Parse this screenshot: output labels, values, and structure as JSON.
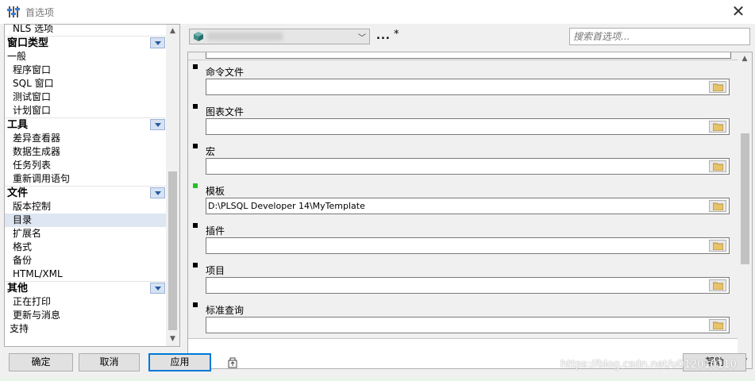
{
  "window": {
    "title": "首选项",
    "close_symbol": "✕",
    "icon": "sliders-icon"
  },
  "tree": {
    "items": [
      {
        "type": "item",
        "label": "NLS 选项"
      },
      {
        "type": "category",
        "label": "窗口类型"
      },
      {
        "type": "general",
        "label": "一般"
      },
      {
        "type": "item",
        "label": "程序窗口"
      },
      {
        "type": "item",
        "label": "SQL 窗口"
      },
      {
        "type": "item",
        "label": "测试窗口"
      },
      {
        "type": "item",
        "label": "计划窗口"
      },
      {
        "type": "category",
        "label": "工具"
      },
      {
        "type": "item",
        "label": "差异查看器"
      },
      {
        "type": "item",
        "label": "数据生成器"
      },
      {
        "type": "item",
        "label": "任务列表"
      },
      {
        "type": "item",
        "label": "重新调用语句"
      },
      {
        "type": "category",
        "label": "文件"
      },
      {
        "type": "item",
        "label": "版本控制"
      },
      {
        "type": "item",
        "label": "目录",
        "selected": true
      },
      {
        "type": "item",
        "label": "扩展名"
      },
      {
        "type": "item",
        "label": "格式"
      },
      {
        "type": "item",
        "label": "备份"
      },
      {
        "type": "item",
        "label": "HTML/XML"
      },
      {
        "type": "category",
        "label": "其他"
      },
      {
        "type": "item",
        "label": "正在打印"
      },
      {
        "type": "item",
        "label": "更新与消息"
      },
      {
        "type": "support",
        "label": "支持"
      }
    ]
  },
  "toolbar": {
    "connection_value": "",
    "more_label": "...",
    "modified_mark": "*",
    "search_placeholder": "搜索首选项..."
  },
  "prefs": [
    {
      "label": "命令文件",
      "value": "",
      "marker": "black"
    },
    {
      "label": "图表文件",
      "value": "",
      "marker": "black"
    },
    {
      "label": "宏",
      "value": "",
      "marker": "black"
    },
    {
      "label": "模板",
      "value": "D:\\PLSQL Developer 14\\MyTemplate",
      "marker": "green"
    },
    {
      "label": "插件",
      "value": "",
      "marker": "black"
    },
    {
      "label": "项目",
      "value": "",
      "marker": "black"
    },
    {
      "label": "标准查询",
      "value": "",
      "marker": "black"
    }
  ],
  "buttons": {
    "ok": "确定",
    "cancel": "取消",
    "apply": "应用",
    "help": "帮助"
  },
  "colors": {
    "marker_black": "#000000",
    "marker_green": "#22c222",
    "selected_bg": "#dde6f2",
    "accent": "#0078d7"
  },
  "watermark": "https://blog.csdn.net/u012010110"
}
